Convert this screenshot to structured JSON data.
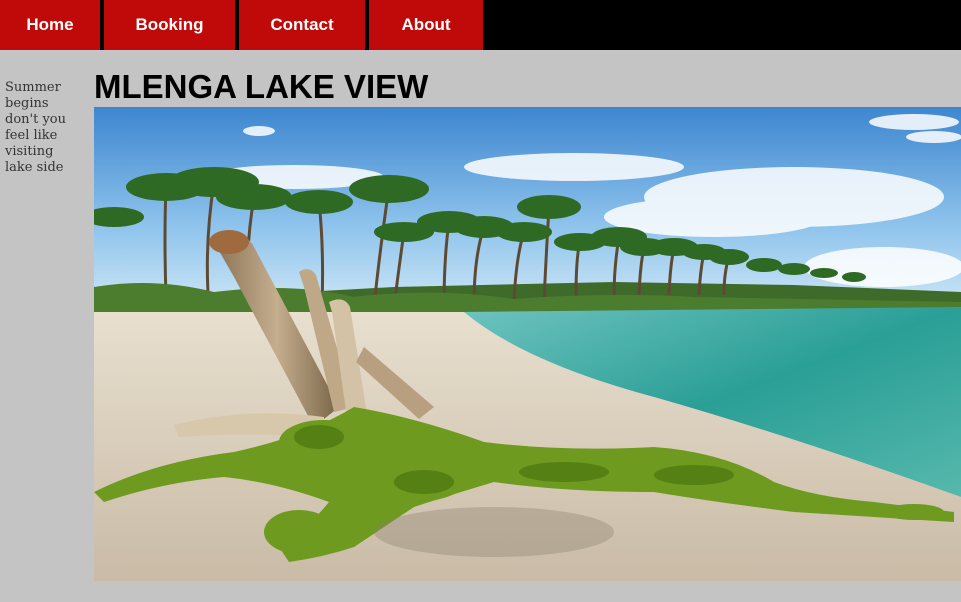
{
  "nav": {
    "items": [
      {
        "label": "Home"
      },
      {
        "label": "Booking"
      },
      {
        "label": "Contact"
      },
      {
        "label": "About"
      }
    ]
  },
  "sidebar": {
    "text": "Summer begins don't you feel like visiting lake side"
  },
  "main": {
    "title": "MLENGA LAKE VIEW"
  },
  "colors": {
    "page_background": "#c4c4c4",
    "nav_background": "#000000",
    "nav_item_background": "#c00a0a",
    "nav_text": "#ffffff"
  }
}
